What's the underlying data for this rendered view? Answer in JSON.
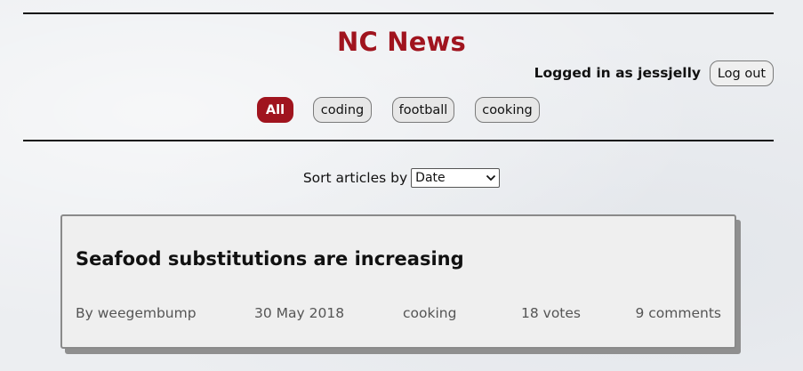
{
  "header": {
    "site_title": "NC News",
    "login_status": "Logged in as jessjelly",
    "logout_label": "Log out"
  },
  "topics": [
    {
      "label": "All",
      "active": true
    },
    {
      "label": "coding",
      "active": false
    },
    {
      "label": "football",
      "active": false
    },
    {
      "label": "cooking",
      "active": false
    }
  ],
  "sort": {
    "label": "Sort articles by",
    "selected": "Date"
  },
  "articles": [
    {
      "title": "Seafood substitutions are increasing",
      "author": "By weegembump",
      "date": "30 May 2018",
      "topic": "cooking",
      "votes": "18 votes",
      "comments": "9 comments"
    }
  ],
  "colors": {
    "brand": "#a0141e",
    "card_bg": "#efefef",
    "page_bg": "#eceef1"
  },
  "icons": {
    "sort_dropdown": "chevron-down-icon"
  }
}
